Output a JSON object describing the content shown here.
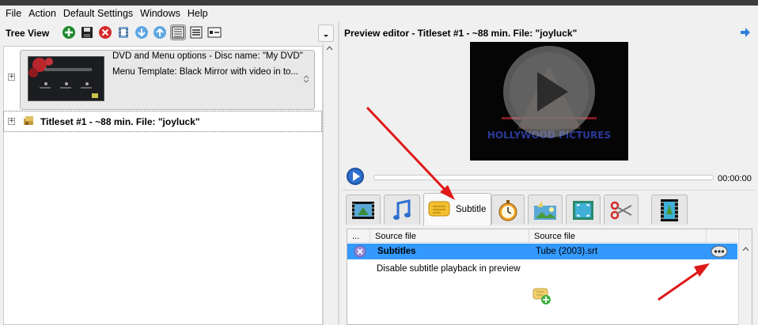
{
  "menu": [
    "File",
    "Action",
    "Default Settings",
    "Windows",
    "Help"
  ],
  "left": {
    "title": "Tree View",
    "tree": {
      "dvd_line1": "DVD and Menu options - Disc name: \"My DVD\"",
      "dvd_line2": "Menu Template: Black Mirror with video in to...",
      "titleset": "Titleset #1 - ~88 min. File: \"joyluck\""
    }
  },
  "right": {
    "preview_title": "Preview editor - Titleset #1 - ~88 min. File: \"joyluck\"",
    "time": "00:00:00",
    "progress": 0,
    "tabs": [
      "video",
      "audio",
      "Subtitle",
      "chapters",
      "effects",
      "crop",
      "cut",
      "film"
    ],
    "active_tab_label": "Subtitle",
    "grid": {
      "col0": "...",
      "col1": "Source file",
      "col2": "Source file",
      "row1": {
        "name": "Subtitles",
        "file": "Tube (2003).srt"
      },
      "row2": "Disable subtitle playback in preview"
    }
  },
  "colors": {
    "selection": "#3399ff",
    "arrow": "#e01818"
  }
}
